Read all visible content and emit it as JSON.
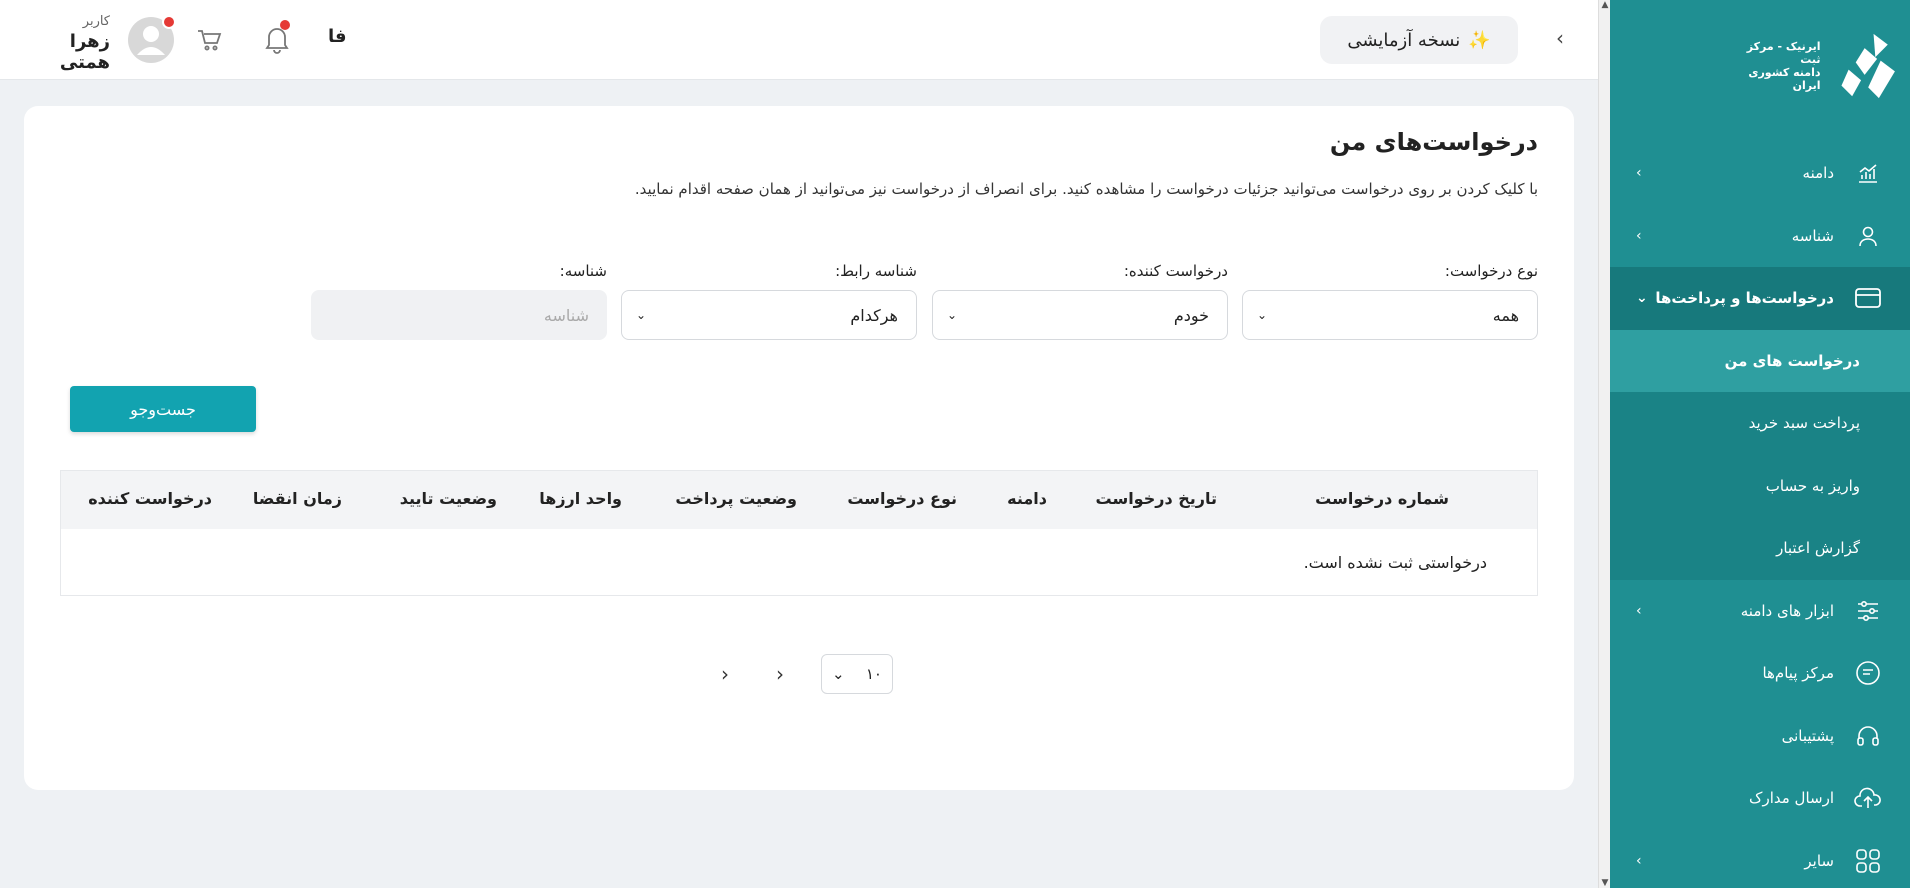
{
  "header": {
    "user_role": "کاربر",
    "user_name": "زهرا همتی",
    "lang": "فا",
    "trial": "نسخه آزمایشی",
    "trial_icon": "sparkles-icon"
  },
  "sidebar": {
    "logo_line1": "ایرنیک - مرکز ثبت",
    "logo_line2": "دامنه کشوری ایران",
    "items": [
      {
        "label": "دامنه",
        "icon": "chart-icon"
      },
      {
        "label": "شناسه",
        "icon": "user-icon"
      },
      {
        "label": "درخواست‌ها و پرداخت‌ها",
        "icon": "card-icon"
      },
      {
        "label": "ابزار های دامنه",
        "icon": "sliders-icon"
      },
      {
        "label": "مرکز پیام‌ها",
        "icon": "message-icon"
      },
      {
        "label": "پشتیبانی",
        "icon": "headset-icon"
      },
      {
        "label": "ارسال مدارک",
        "icon": "upload-icon"
      },
      {
        "label": "سایر",
        "icon": "grid-icon"
      }
    ],
    "sub_items": [
      {
        "label": "درخواست های من"
      },
      {
        "label": "پرداخت سبد خرید"
      },
      {
        "label": "واریز به حساب"
      },
      {
        "label": "گزارش اعتبار"
      }
    ]
  },
  "main": {
    "title": "درخواست‌های من",
    "description": "با کلیک کردن بر روی درخواست می‌توانید جزئیات درخواست را مشاهده کنید. برای انصراف از درخواست نیز می‌توانید از همان صفحه اقدام نمایید.",
    "filters": {
      "type_label": "نوع درخواست:",
      "type_value": "همه",
      "requester_label": "درخواست کننده:",
      "requester_value": "خودم",
      "contact_label": "شناسه رابط:",
      "contact_value": "هرکدام",
      "id_label": "شناسه:",
      "id_placeholder": "شناسه"
    },
    "search_label": "جست‌وجو",
    "table": {
      "headers": [
        "شماره درخواست",
        "تاریخ درخواست",
        "دامنه",
        "نوع درخواست",
        "وضعیت پرداخت",
        "واحد ارزها",
        "وضعیت تایید",
        "زمان انقضا",
        "درخواست کننده"
      ],
      "empty_text": "درخواستی ثبت نشده است."
    },
    "pagination": {
      "page_size": "۱۰"
    }
  },
  "colors": {
    "sidebar": "#1f8f92",
    "accent_button": "#12a3b0",
    "notification": "#e53935"
  }
}
